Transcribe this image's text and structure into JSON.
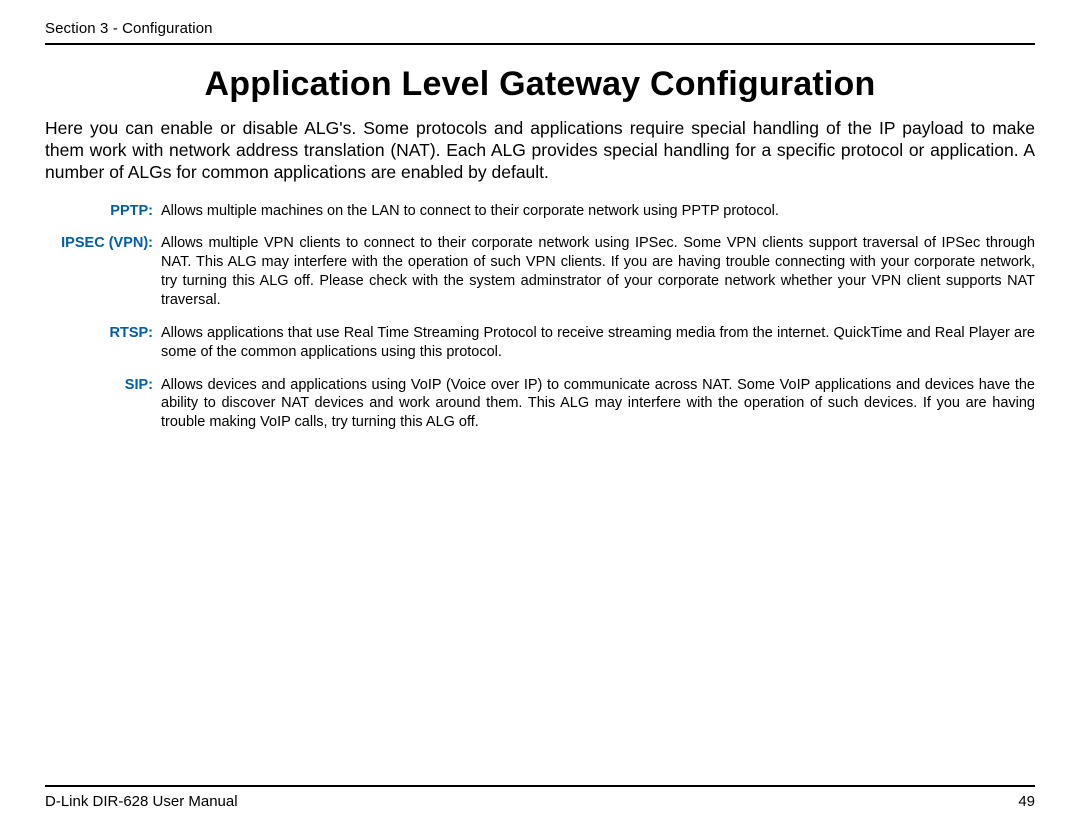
{
  "header": {
    "section_label": "Section 3 - Configuration"
  },
  "title": "Application Level Gateway Configuration",
  "intro": "Here you can enable or disable ALG's. Some protocols and applications require special handling of the IP payload to make them work with network address translation (NAT). Each ALG provides special handling for a specific protocol or application. A number of ALGs for common applications are enabled by default.",
  "definitions": [
    {
      "term": "PPTP:",
      "desc": "Allows multiple machines on the LAN to connect to their corporate network using PPTP protocol."
    },
    {
      "term": "IPSEC (VPN):",
      "desc": "Allows multiple VPN clients to connect to their corporate network using IPSec. Some VPN clients support traversal of IPSec through NAT. This ALG may interfere with the operation of such VPN clients. If you are having trouble connecting with your corporate network, try turning this ALG off. Please check with the system adminstrator of your corporate network whether your VPN client supports NAT traversal."
    },
    {
      "term": "RTSP:",
      "desc": "Allows applications that use Real Time Streaming Protocol to receive streaming media from the internet. QuickTime and Real Player are some of the common applications using this protocol."
    },
    {
      "term": "SIP:",
      "desc": "Allows devices and applications using VoIP (Voice over IP) to communicate across NAT. Some VoIP applications and devices have the ability to discover NAT devices and work around them. This ALG may interfere with the operation of such devices. If you are having trouble making VoIP calls, try turning this ALG off."
    }
  ],
  "footer": {
    "manual": "D-Link DIR-628 User Manual",
    "page": "49"
  }
}
